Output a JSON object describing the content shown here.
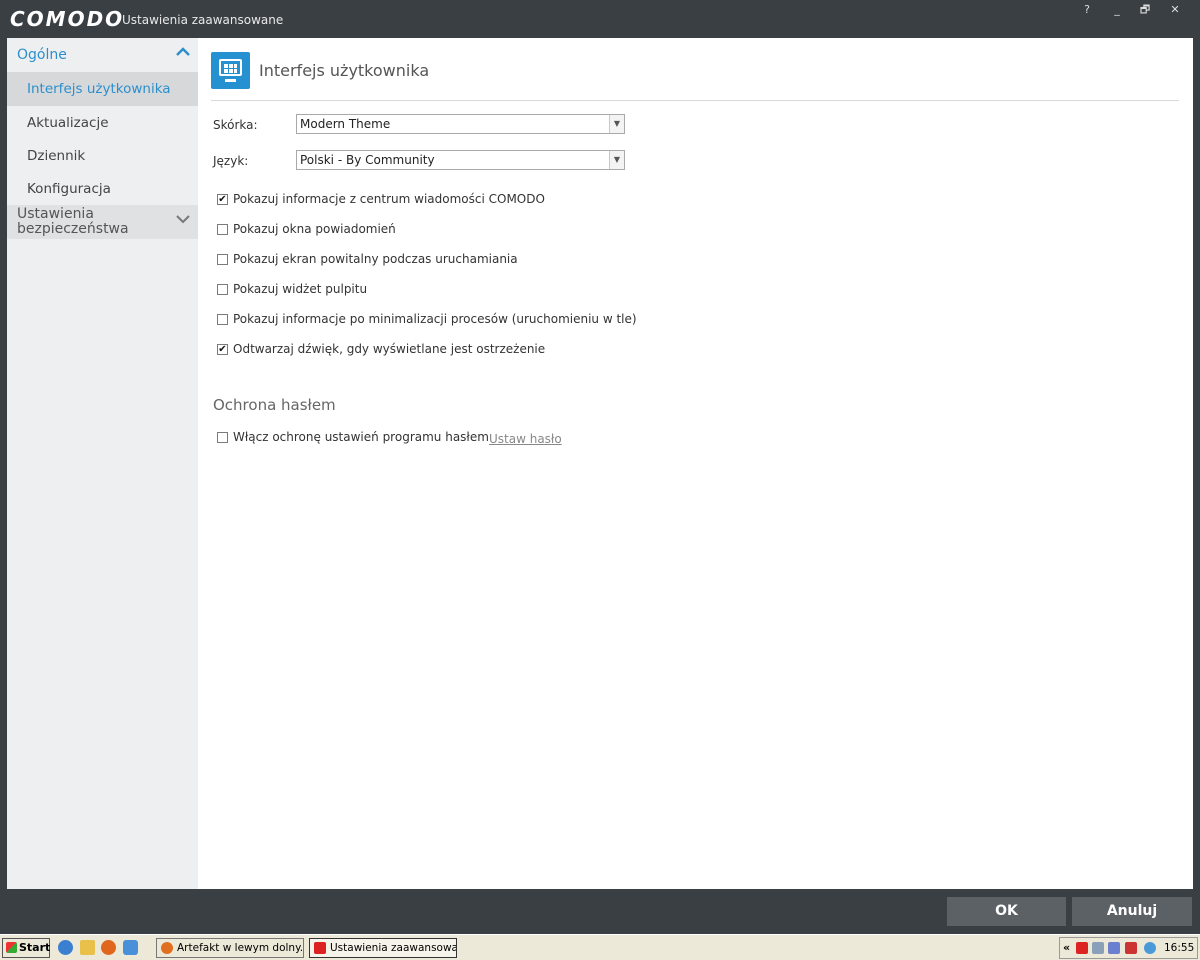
{
  "window": {
    "brand": "COMODO",
    "title": "Ustawienia zaawansowane",
    "controls": {
      "help": "?",
      "minimize": "_",
      "restore": "🗗",
      "close": "✕"
    }
  },
  "sidebar": {
    "sections": [
      {
        "label": "Ogólne",
        "expanded": true,
        "items": [
          {
            "label": "Interfejs użytkownika",
            "active": true
          },
          {
            "label": "Aktualizacje"
          },
          {
            "label": "Dziennik"
          },
          {
            "label": "Konfiguracja"
          }
        ]
      },
      {
        "label": "Ustawienia bezpieczeństwa",
        "label_line1": "Ustawienia",
        "label_line2": "bezpieczeństwa",
        "expanded": false
      }
    ]
  },
  "content": {
    "title": "Interfejs użytkownika",
    "icon": "monitor-icon",
    "skin": {
      "label": "Skórka:",
      "value": "Modern Theme"
    },
    "language": {
      "label": "Język:",
      "value": "Polski - By Community"
    },
    "options": [
      {
        "label": "Pokazuj informacje z centrum wiadomości COMODO",
        "checked": true
      },
      {
        "label": "Pokazuj okna powiadomień",
        "checked": false
      },
      {
        "label": "Pokazuj ekran powitalny podczas uruchamiania",
        "checked": false
      },
      {
        "label": "Pokazuj widżet pulpitu",
        "checked": false
      },
      {
        "label": "Pokazuj informacje po minimalizacji procesów (uruchomieniu w tle)",
        "checked": false
      },
      {
        "label": "Odtwarzaj dźwięk, gdy wyświetlane jest ostrzeżenie",
        "checked": true
      }
    ],
    "password": {
      "section_title": "Ochrona hasłem",
      "option": {
        "label": "Włącz ochronę ustawień programu hasłem",
        "checked": false
      },
      "link": "Ustaw hasło"
    }
  },
  "buttons": {
    "ok": "OK",
    "cancel": "Anuluj"
  },
  "taskbar": {
    "start": "Start",
    "tasks": [
      {
        "label": "Artefakt w lewym dolny..."
      },
      {
        "label": "Ustawienia zaawansowa..."
      }
    ],
    "tray_expand": "«",
    "clock": "16:55"
  },
  "colors": {
    "accent": "#2c8fcc",
    "titlebar": "#3a3f44",
    "sidebar": "#eeeff0",
    "button": "#5c6166"
  }
}
